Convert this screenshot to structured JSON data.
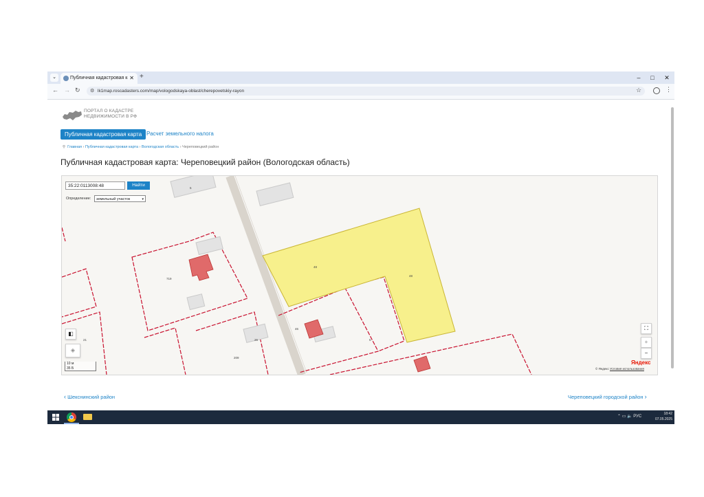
{
  "browser": {
    "tab_title": "Публичная кадастровая карта",
    "tab_close": "✕",
    "new_tab": "+",
    "url": "lk1map.roscadasters.com/map/vologodskaya-oblast/cherepovetskiy-rayon",
    "window_minimize": "–",
    "window_restore": "□",
    "window_close": "✕"
  },
  "portal": {
    "logo_line1": "ПОРТАЛ О КАДАСТРЕ",
    "logo_line2": "НЕДВИЖИМОСТИ В РФ"
  },
  "nav": {
    "tab_map": "Публичная кадастровая карта",
    "tab_tax": "Расчет земельного налога"
  },
  "breadcrumb": {
    "home": "Главная",
    "map": "Публичная кадастровая карта",
    "region": "Вологодская область",
    "current": "Череповецкий район",
    "sep": "›"
  },
  "page_title": "Публичная кадастровая карта: Череповецкий район (Вологодская область)",
  "map": {
    "search_value": "35:22:0113008:48",
    "search_button": "Найти",
    "definition_label": "Определение:",
    "definition_value": "земельный участок",
    "scale_label_1": "10 м",
    "scale_label_2": "35 Б",
    "zoom_in": "+",
    "zoom_out": "−",
    "fullscreen": "⛶",
    "yandex_logo": "Яндекс",
    "yandex_copyright": "© Яндекс",
    "yandex_terms": "Условия использования",
    "labels": {
      "building_top": "5",
      "plot_yellow_a": "48",
      "plot_yellow_b": "48",
      "plot_left": "719",
      "building_mid": "26",
      "label_46": "46",
      "label_5": "5",
      "label_209": "209",
      "label_21": "21"
    }
  },
  "pager": {
    "prev": "Шекснинский район",
    "next": "Череповецкий городской район"
  },
  "taskbar": {
    "tray_lang": "РУС",
    "time": "18:42",
    "date": "07.05.2025"
  },
  "colors": {
    "accent": "#1d83c7",
    "parcel_yellow": "#f7f08c",
    "parcel_border": "#c8102e",
    "building_red": "#e06a6a"
  }
}
